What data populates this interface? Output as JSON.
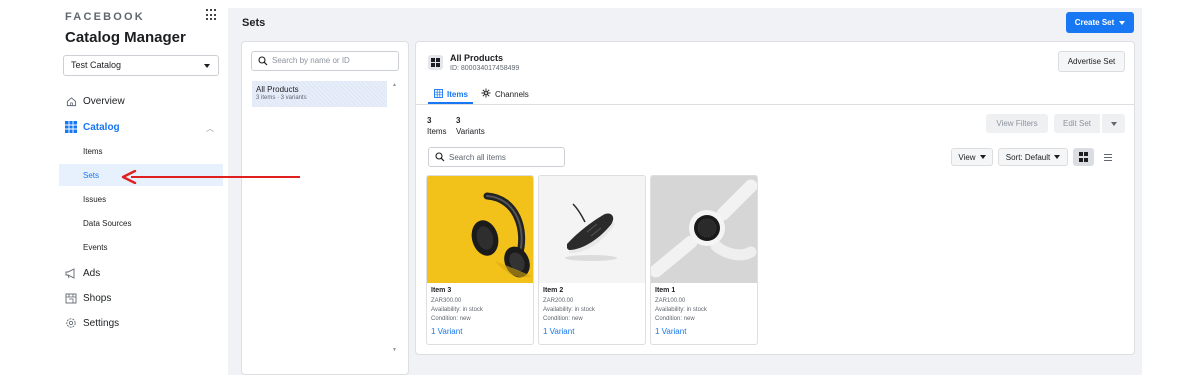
{
  "sidebar": {
    "brand": "FACEBOOK",
    "title": "Catalog Manager",
    "catalog_select": "Test Catalog",
    "nav": {
      "overview": "Overview",
      "catalog": "Catalog",
      "ads": "Ads",
      "shops": "Shops",
      "settings": "Settings"
    },
    "catalog_sub": {
      "items": "Items",
      "sets": "Sets",
      "issues": "Issues",
      "data_sources": "Data Sources",
      "events": "Events"
    }
  },
  "header": {
    "page_title": "Sets",
    "create_set": "Create Set"
  },
  "sets_panel": {
    "search_placeholder": "Search by name or ID",
    "sets": [
      {
        "name": "All Products",
        "meta": "3 items · 3 variants"
      }
    ]
  },
  "detail": {
    "set_title": "All Products",
    "set_id": "ID: 800034017458499",
    "advertise_set": "Advertise Set",
    "tabs": {
      "items": "Items",
      "channels": "Channels"
    },
    "counts": {
      "items_num": "3",
      "items_label": "Items",
      "variants_num": "3",
      "variants_label": "Variants"
    },
    "view_filters": "View Filters",
    "edit_set": "Edit Set",
    "search_items_placeholder": "Search all items",
    "view_dropdown": "View",
    "sort_dropdown": "Sort: Default",
    "products": [
      {
        "name": "Item 3",
        "price": "ZAR300.00",
        "availability": "Availability: in stock",
        "condition": "Condition: new",
        "variant": "1 Variant",
        "image": "headphones"
      },
      {
        "name": "Item 2",
        "price": "ZAR200.00",
        "availability": "Availability: in stock",
        "condition": "Condition: new",
        "variant": "1 Variant",
        "image": "sneaker"
      },
      {
        "name": "Item 1",
        "price": "ZAR100.00",
        "availability": "Availability: in stock",
        "condition": "Condition: new",
        "variant": "1 Variant",
        "image": "smartwatch"
      }
    ]
  },
  "colors": {
    "accent": "#1877f2",
    "annotation_arrow": "#e02020",
    "headphones_bg": "#f2c21b"
  }
}
